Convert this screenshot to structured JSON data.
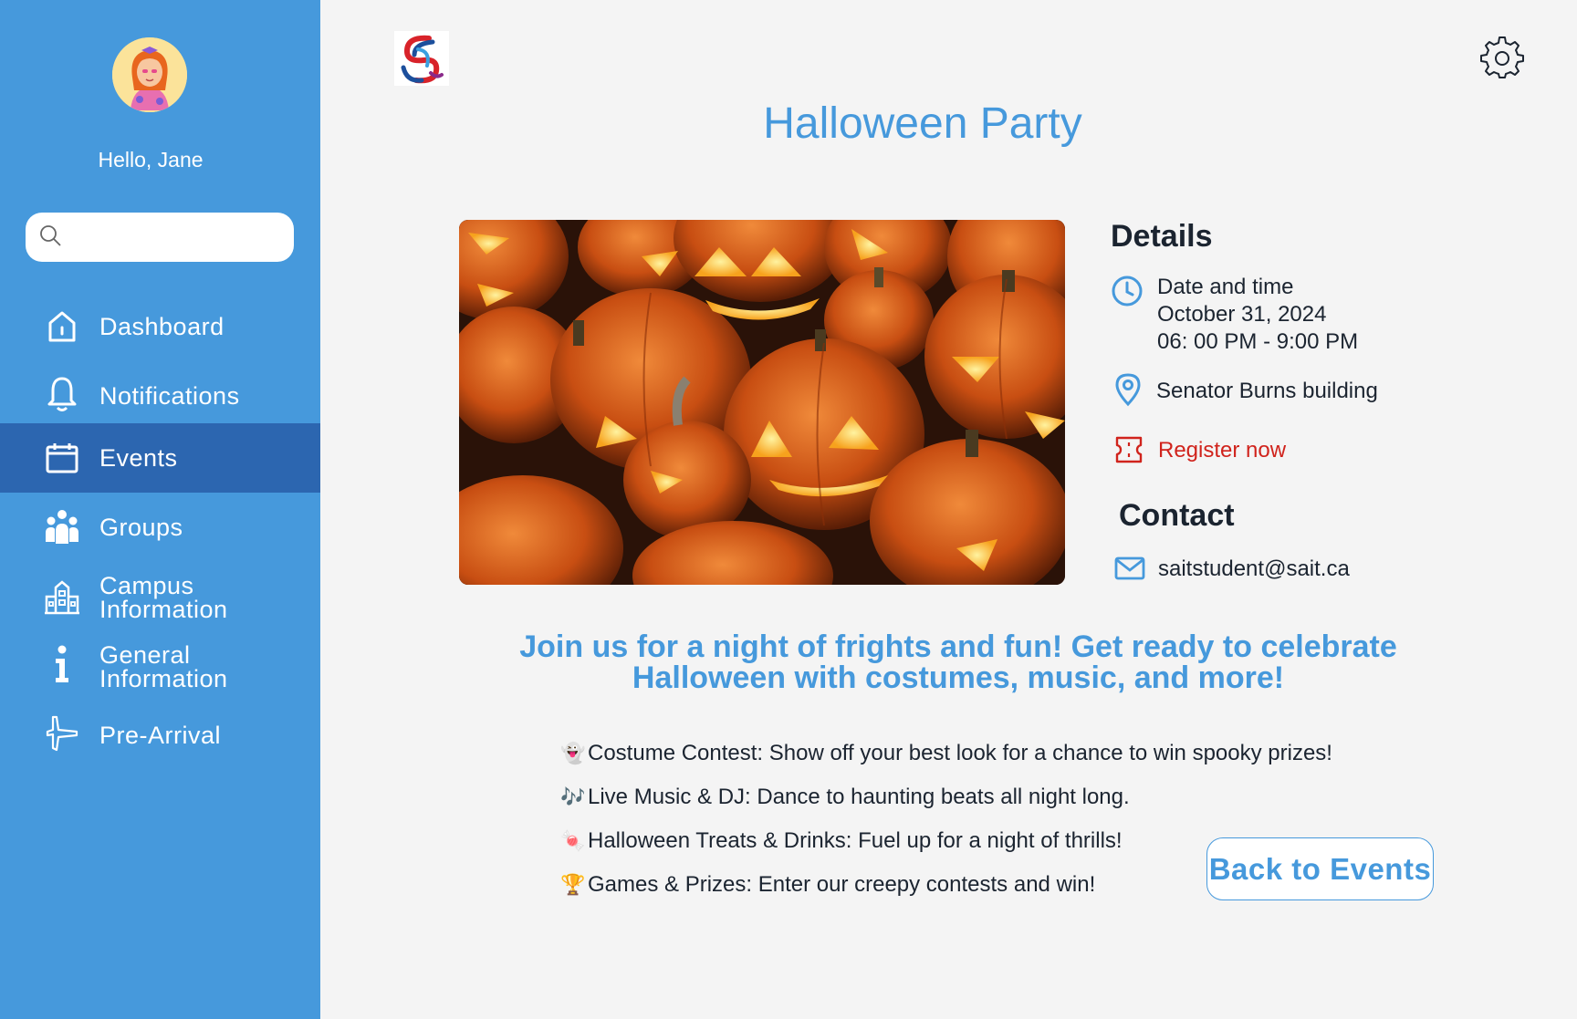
{
  "sidebar": {
    "greeting": "Hello, Jane",
    "search": {
      "placeholder": "",
      "value": ""
    },
    "items": [
      {
        "label": "Dashboard",
        "icon": "home-icon",
        "active": false
      },
      {
        "label": "Notifications",
        "icon": "bell-icon",
        "active": false
      },
      {
        "label": "Events",
        "icon": "calendar-icon",
        "active": true
      },
      {
        "label": "Groups",
        "icon": "people-icon",
        "active": false
      },
      {
        "label": "Campus\nInformation",
        "icon": "building-icon",
        "active": false
      },
      {
        "label": "General\nInformation",
        "icon": "info-icon",
        "active": false
      },
      {
        "label": "Pre-Arrival",
        "icon": "airplane-icon",
        "active": false
      }
    ]
  },
  "header": {
    "title": "Halloween Party"
  },
  "details": {
    "heading": "Details",
    "date_label": "Date and time",
    "date": "October 31, 2024",
    "time": "06: 00 PM - 9:00 PM",
    "location": "Senator Burns building",
    "register": "Register now"
  },
  "contact": {
    "heading": "Contact",
    "email": "saitstudent@sait.ca"
  },
  "tagline": "Join us for a night of frights and fun! Get ready to celebrate Halloween with costumes, music, and more!",
  "highlights": [
    {
      "emoji": "👻",
      "text": "Costume Contest: Show off your best look for a chance to win spooky prizes!"
    },
    {
      "emoji": "🎶",
      "text": "Live Music & DJ: Dance to haunting beats all night long."
    },
    {
      "emoji": "🍬",
      "text": "Halloween Treats & Drinks: Fuel up for a night of thrills!"
    },
    {
      "emoji": "🏆",
      "text": "Games & Prizes: Enter our creepy contests and win!"
    }
  ],
  "back_button": "Back to Events",
  "colors": {
    "sidebar": "#4699dc",
    "sidebar_active": "#2c66b0",
    "accent": "#4699dc",
    "register": "#d0231c",
    "text": "#1b2430",
    "background": "#f4f4f4"
  }
}
